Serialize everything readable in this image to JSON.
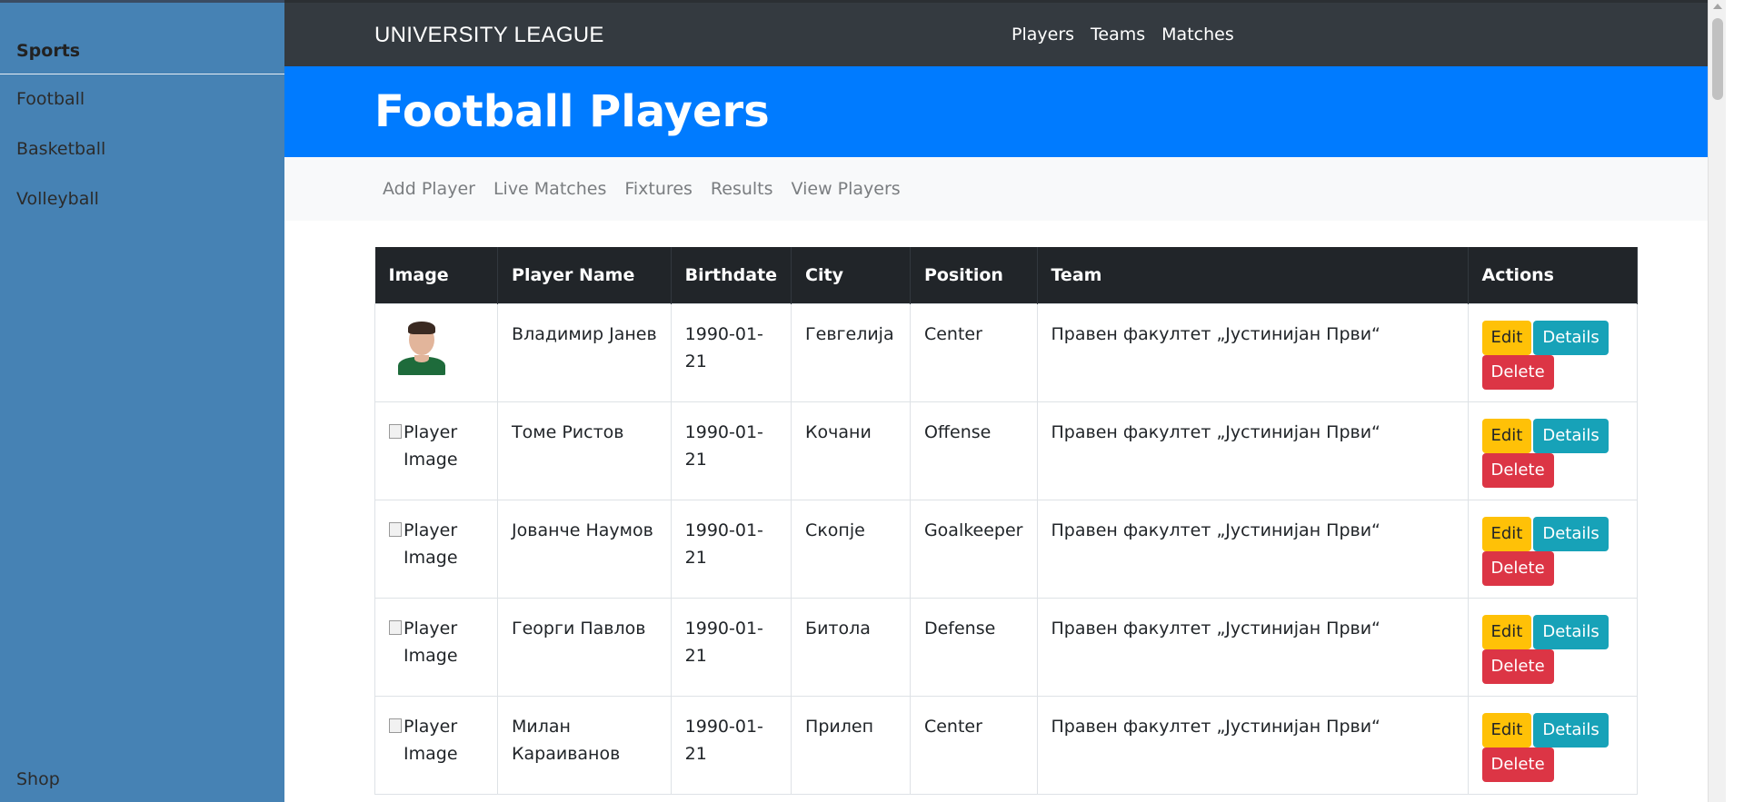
{
  "sidebar": {
    "brand": "Sports",
    "items": [
      {
        "label": "Football"
      },
      {
        "label": "Basketball"
      },
      {
        "label": "Volleyball"
      }
    ],
    "shop": "Shop"
  },
  "topnav": {
    "title": "UNIVERSITY LEAGUE",
    "links": [
      "Players",
      "Teams",
      "Matches"
    ]
  },
  "hero": {
    "title": "Football Players"
  },
  "subnav": [
    "Add Player",
    "Live Matches",
    "Fixtures",
    "Results",
    "View Players"
  ],
  "table": {
    "headers": [
      "Image",
      "Player Name",
      "Birthdate",
      "City",
      "Position",
      "Team",
      "Actions"
    ],
    "rows": [
      {
        "image_alt": "",
        "name": "Владимир Јанев",
        "birthdate_a": "1990-01-",
        "birthdate_b": "21",
        "city": "Гевгелија",
        "position": "Center",
        "team": "Правен факултет „Јустинијан Први“"
      },
      {
        "image_alt": "Player Image",
        "name": "Томе Ристов",
        "birthdate_a": "1990-01-",
        "birthdate_b": "21",
        "city": "Кочани",
        "position": "Offense",
        "team": "Правен факултет „Јустинијан Први“"
      },
      {
        "image_alt": "Player Image",
        "name": "Јованче Наумов",
        "birthdate_a": "1990-01-",
        "birthdate_b": "21",
        "city": "Скопје",
        "position": "Goalkeeper",
        "team": "Правен факултет „Јустинијан Први“"
      },
      {
        "image_alt": "Player Image",
        "name": "Георги Павлов",
        "birthdate_a": "1990-01-",
        "birthdate_b": "21",
        "city": "Битола",
        "position": "Defense",
        "team": "Правен факултет „Јустинијан Први“"
      },
      {
        "image_alt": "Player Image",
        "name": "Милан Караиванов",
        "birthdate_a": "1990-01-",
        "birthdate_b": "21",
        "city": "Прилеп",
        "position": "Center",
        "team": "Правен факултет „Јустинијан Први“"
      }
    ],
    "actions": {
      "edit": "Edit",
      "details": "Details",
      "delete": "Delete"
    }
  },
  "colors": {
    "sidebar_bg": "#4682b4",
    "topnav_bg": "#343a40",
    "hero_bg": "#007bff",
    "edit_btn": "#ffc107",
    "details_btn": "#17a2b8",
    "delete_btn": "#dc3545"
  }
}
